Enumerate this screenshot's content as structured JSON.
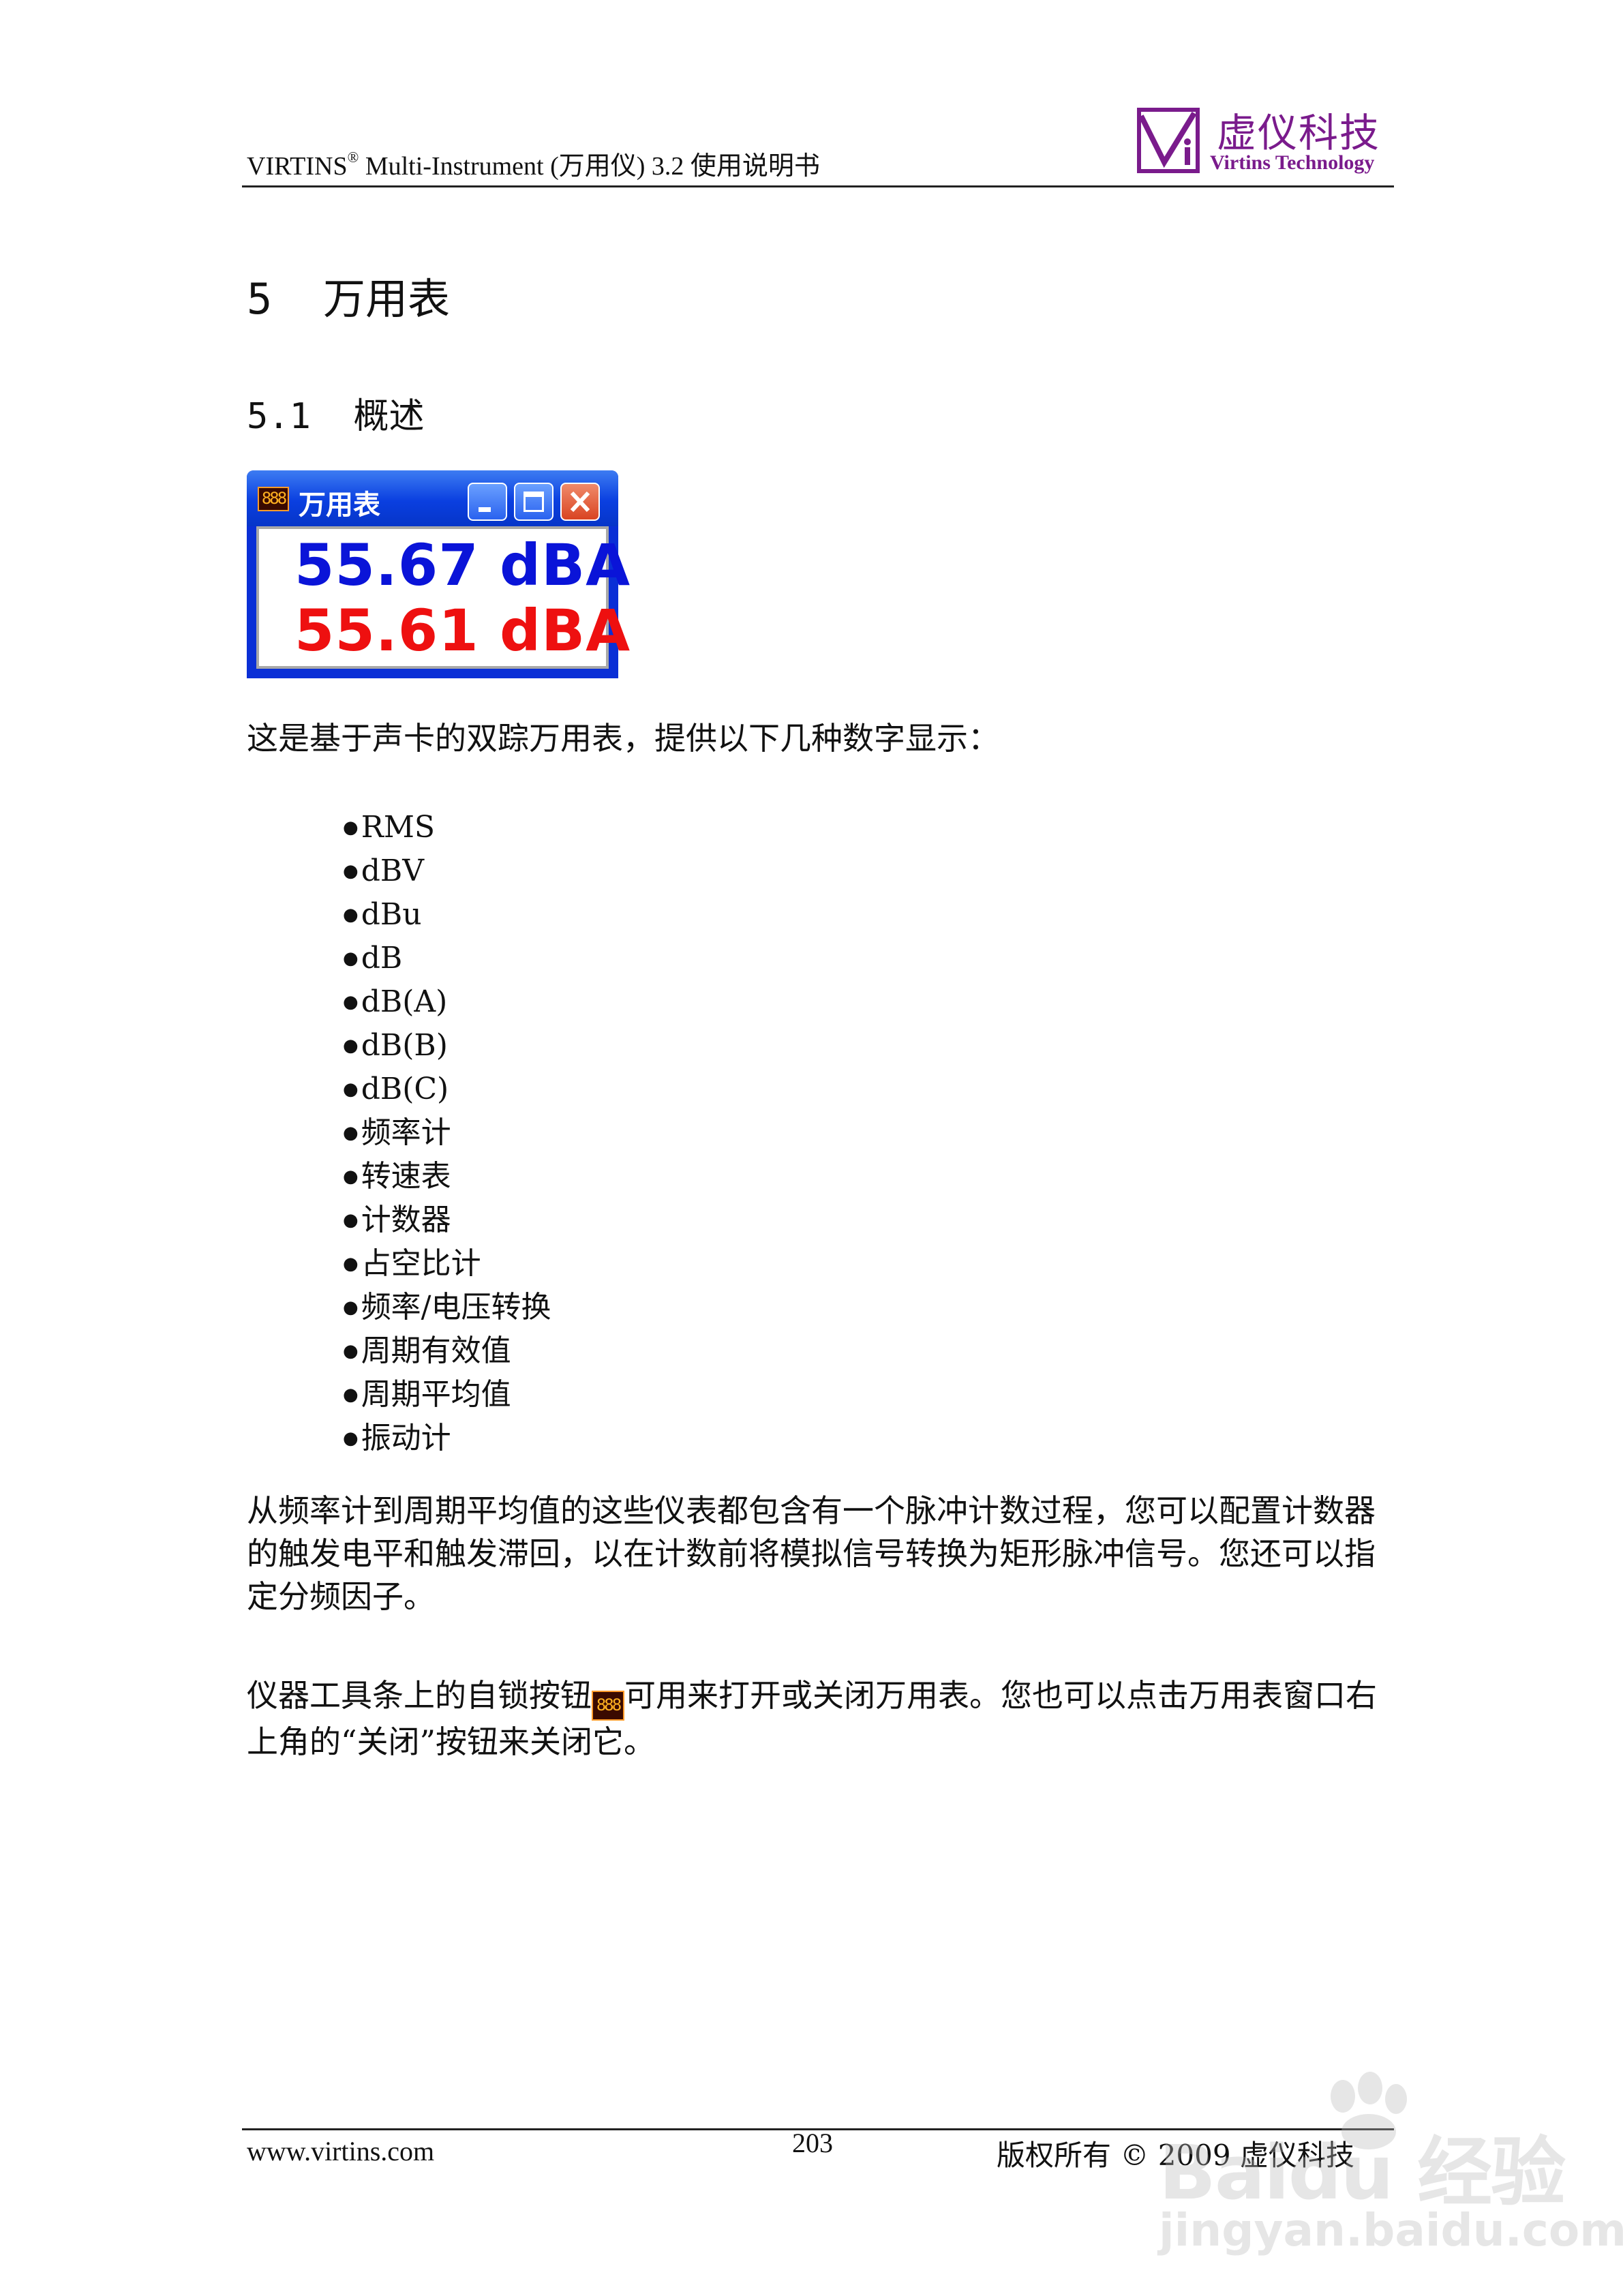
{
  "header": {
    "title_pre": "VIRTINS",
    "title_sup": "®",
    "title_post": " Multi-Instrument (万用仪) 3.2 使用说明书",
    "logo_cn": "虚仪科技",
    "logo_en": "Virtins Technology"
  },
  "section": {
    "number": "5",
    "title": "万用表"
  },
  "subsection": {
    "number": "5.1",
    "title": "概述"
  },
  "window": {
    "icon_glyph": "888",
    "title": "万用表",
    "reading1": "55.67 dBA",
    "reading2": "55.61 dBA",
    "colors": {
      "reading1": "#0a14d8",
      "reading2": "#ee1010",
      "titlebar": "#0a3fe0"
    }
  },
  "intro": "这是基于声卡的双踪万用表，提供以下几种数字显示：",
  "list": [
    "RMS",
    "dBV",
    "dBu",
    "dB",
    "dB(A)",
    "dB(B)",
    "dB(C)",
    "频率计",
    "转速表",
    "计数器",
    "占空比计",
    "频率/电压转换",
    "周期有效值",
    "周期平均值",
    "振动计"
  ],
  "para1": "从频率计到周期平均值的这些仪表都包含有一个脉冲计数过程，您可以配置计数器的触发电平和触发滞回，以在计数前将模拟信号转换为矩形脉冲信号。您还可以指定分频因子。",
  "para2_before": "仪器工具条上的自锁按钮",
  "para2_icon": "888",
  "para2_after": "可用来打开或关闭万用表。您也可以点击万用表窗口右上角的“关闭”按钮来关闭它。",
  "footer": {
    "url": "www.virtins.com",
    "page": "203",
    "copyright": "版权所有 © 2009 虚仪科技"
  },
  "watermark": {
    "line1": "Baidu 经验",
    "line2": "jingyan.baidu.com"
  }
}
